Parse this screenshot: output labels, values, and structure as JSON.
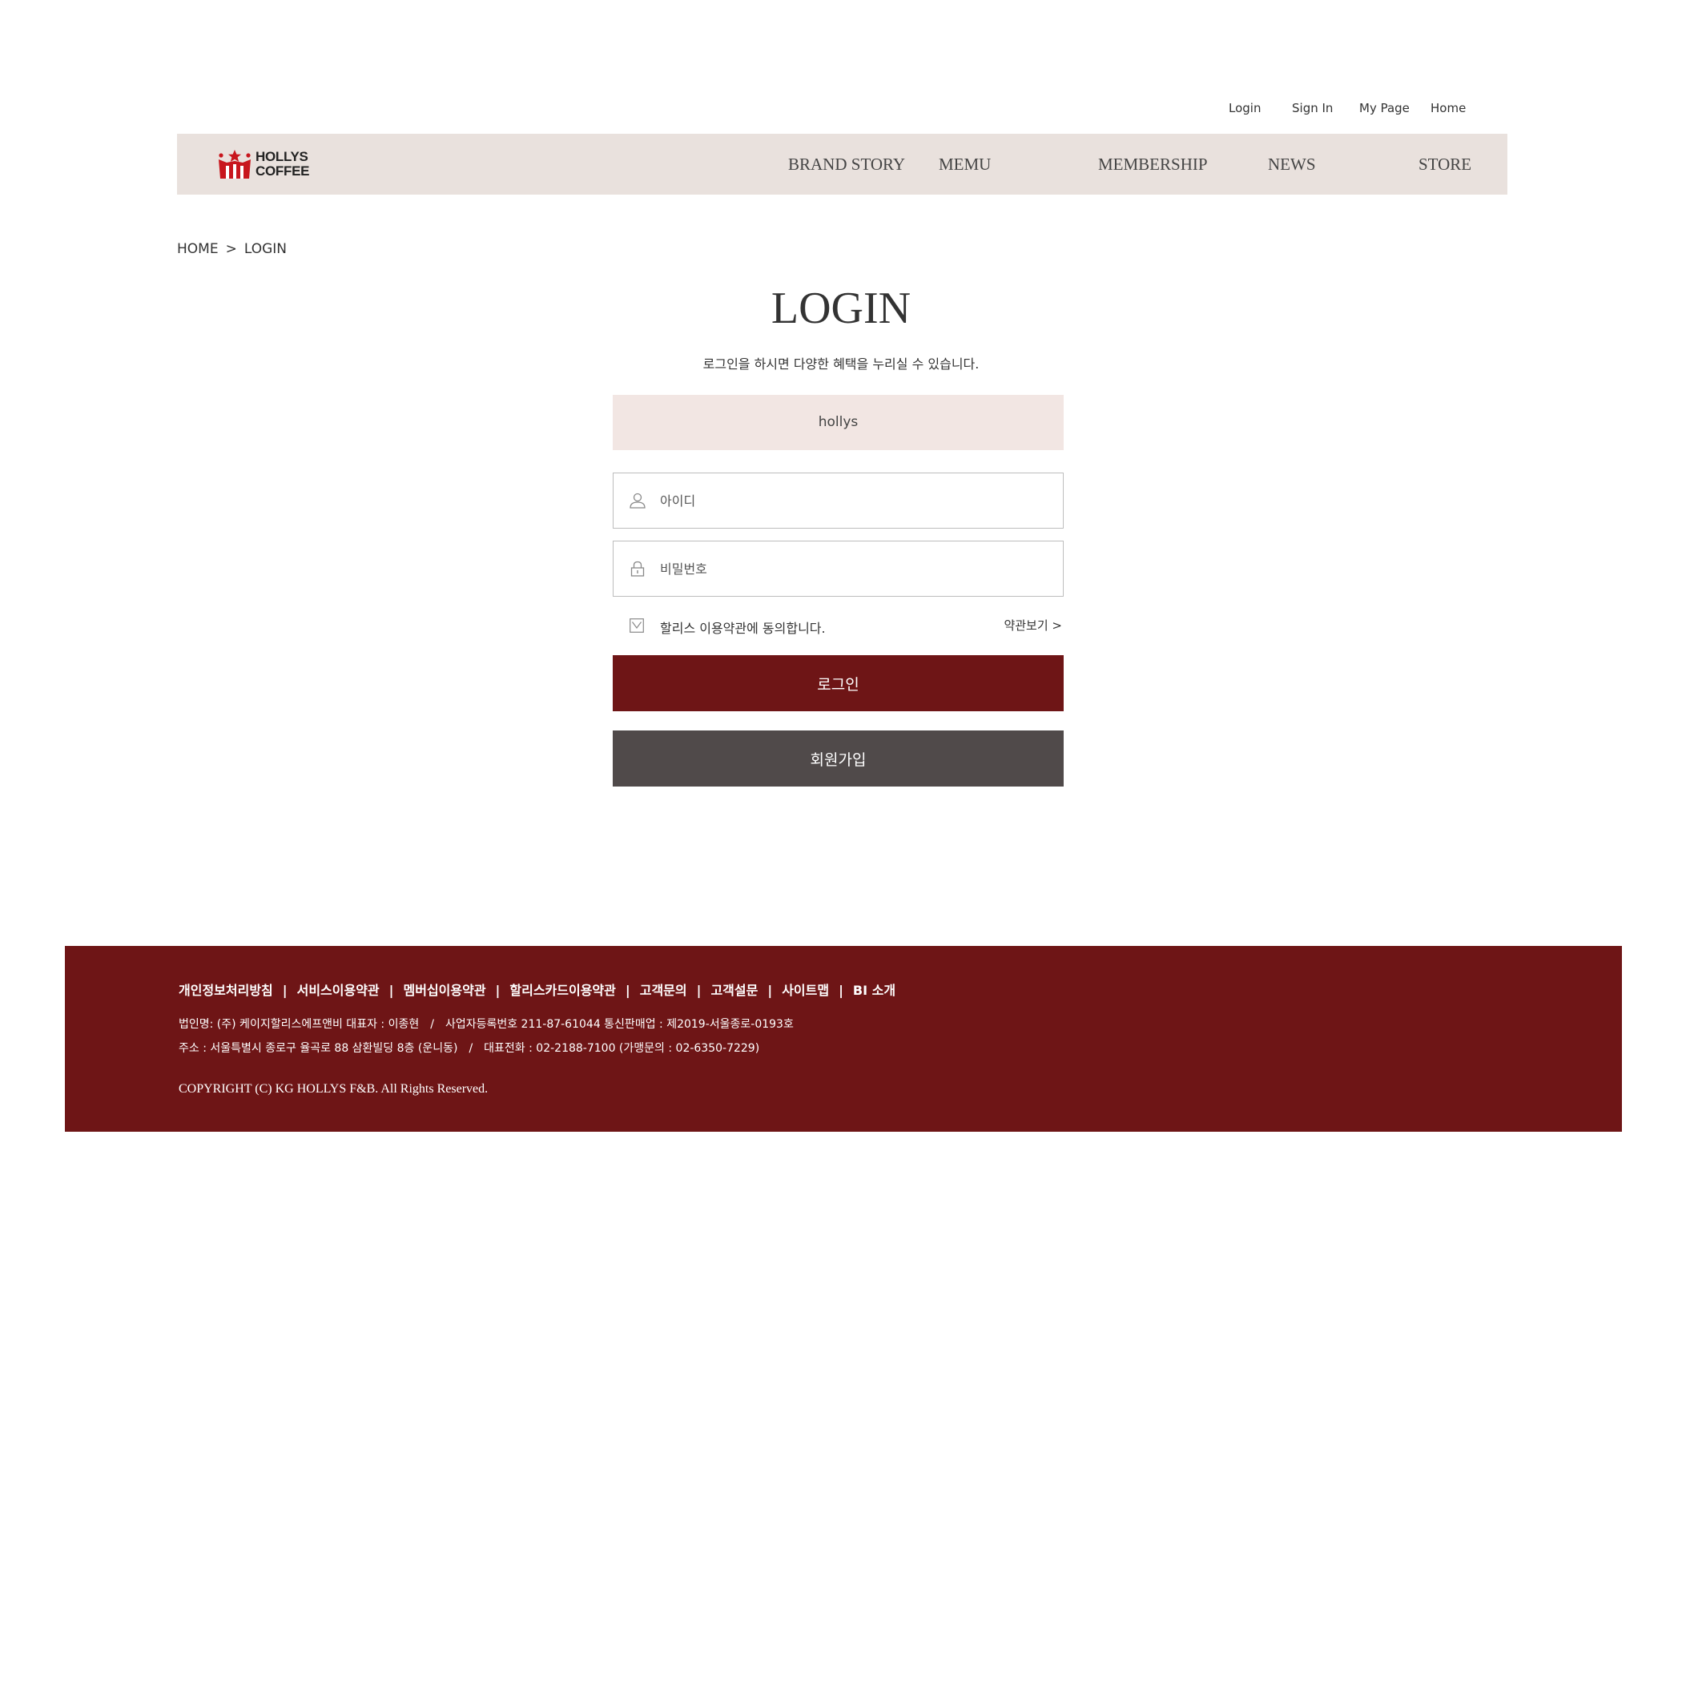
{
  "util_nav": [
    {
      "label": "Login"
    },
    {
      "label": "Sign In"
    },
    {
      "label": "My Page"
    },
    {
      "label": "Home"
    }
  ],
  "header": {
    "logo_line1": "HOLLYS",
    "logo_line2": "COFFEE",
    "nav": [
      "BRAND STORY",
      "MEMU",
      "MEMBERSHIP",
      "NEWS",
      "STORE"
    ]
  },
  "breadcrumb": {
    "home": "HOME",
    "separator": ">",
    "current": "LOGIN"
  },
  "login": {
    "title": "LOGIN",
    "description": "로그인을 하시면 다양한 혜택을 누리실 수 있습니다.",
    "brand_tab": "hollys",
    "id_placeholder": "아이디",
    "pw_placeholder": "비밀번호",
    "agree_text": "할리스 이용약관에 동의합니다.",
    "terms_link": "약관보기 >",
    "login_button": "로그인",
    "join_button": "회원가입"
  },
  "footer": {
    "links": [
      "개인정보처리방침",
      "서비스이용약관",
      "멤버십이용약관",
      "할리스카드이용약관",
      "고객문의",
      "고객설문",
      "사이트맵",
      "BI 소개"
    ],
    "separator": "|",
    "info_line1_a": "법인명: (주) 케이지할리스에프앤비 대표자 : 이종현",
    "info_line1_b": "사업자등록번호 211-87-61044 통신판매업 : 제2019-서울종로-0193호",
    "info_line2_a": "주소 : 서울특별시 종로구 율곡로 88 삼환빌딩 8층 (운니동)",
    "info_line2_b": "대표전화 : 02-2188-7100 (가맹문의 : 02-6350-7229)",
    "info_slash": "/",
    "copyright": "COPYRIGHT (C) KG HOLLYS F&B. All Rights Reserved."
  },
  "colors": {
    "header_bg": "#e9e1dd",
    "brand_box_bg": "#f2e6e3",
    "accent": "#6e1516",
    "join_button": "#504a4a",
    "logo_red": "#c8161d"
  }
}
